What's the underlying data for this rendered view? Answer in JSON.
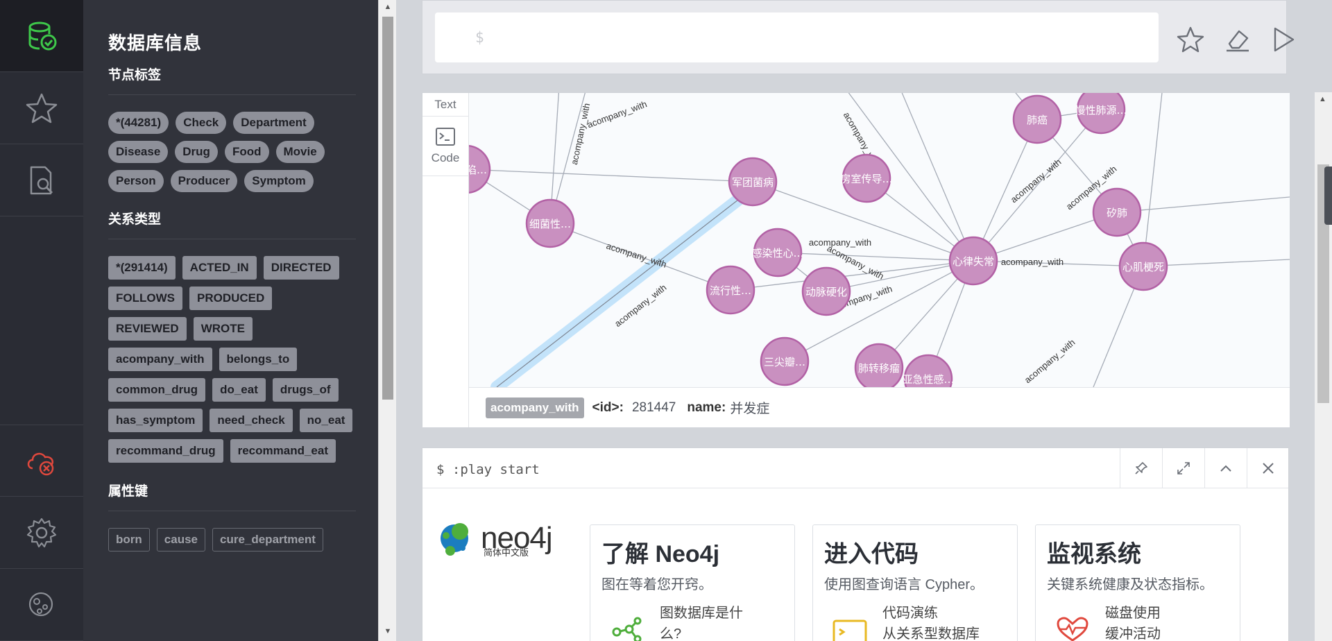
{
  "drawer": {
    "title": "数据库信息",
    "node_labels_heading": "节点标签",
    "node_labels": [
      "*(44281)",
      "Check",
      "Department",
      "Disease",
      "Drug",
      "Food",
      "Movie",
      "Person",
      "Producer",
      "Symptom"
    ],
    "rel_types_heading": "关系类型",
    "rel_types": [
      "*(291414)",
      "ACTED_IN",
      "DIRECTED",
      "FOLLOWS",
      "PRODUCED",
      "REVIEWED",
      "WROTE",
      "acompany_with",
      "belongs_to",
      "common_drug",
      "do_eat",
      "drugs_of",
      "has_symptom",
      "need_check",
      "no_eat",
      "recommand_drug",
      "recommand_eat"
    ],
    "prop_keys_heading": "属性键",
    "prop_keys": [
      "born",
      "cause",
      "cure_department"
    ]
  },
  "rail": {
    "icons": [
      "database-icon",
      "star-icon",
      "search-doc-icon",
      "disconnected-icon",
      "settings-icon",
      "about-icon"
    ]
  },
  "editor": {
    "prompt": "$"
  },
  "frame": {
    "tab_text": "Text",
    "tab_code": "Code",
    "graph": {
      "nodes": [
        {
          "label": "…缺陷…"
        },
        {
          "label": "细菌性…"
        },
        {
          "label": "军团菌病"
        },
        {
          "label": "房室传导…"
        },
        {
          "label": "肺癌"
        },
        {
          "label": "慢性肺源…"
        },
        {
          "label": "矽肺"
        },
        {
          "label": "感染性心…"
        },
        {
          "label": "心律失常"
        },
        {
          "label": "心肌梗死"
        },
        {
          "label": "流行性…"
        },
        {
          "label": "动脉硬化"
        },
        {
          "label": "三尖瓣…"
        },
        {
          "label": "肺转移瘤"
        },
        {
          "label": "亚急性感…"
        }
      ],
      "edge_label": "acompany_with"
    },
    "footer": {
      "badge": "acompany_with",
      "id_label": "<id>:",
      "id_value": "281447",
      "name_label": "name:",
      "name_value": "并发症"
    }
  },
  "play": {
    "command": "$ :play start",
    "logo_word": "neo4j",
    "logo_sub": "简体中文版",
    "cards": [
      {
        "title": "了解 Neo4j",
        "desc": "图在等着您开窍。",
        "item": "图数据库是什么?"
      },
      {
        "title": "进入代码",
        "desc": "使用图查询语言 Cypher。",
        "item": "代码演练\n从关系型数据库"
      },
      {
        "title": "监视系统",
        "desc": "关键系统健康及状态指标。",
        "item": "磁盘使用\n缓冲活动"
      }
    ]
  },
  "colors": {
    "node_fill": "#c990c0",
    "node_stroke": "#b261a5",
    "edge": "#a5abb6",
    "selected_edge": "#c3e3fa",
    "rail_active_icon": "#3ec84a",
    "rail_alert_icon": "#e0483d"
  }
}
